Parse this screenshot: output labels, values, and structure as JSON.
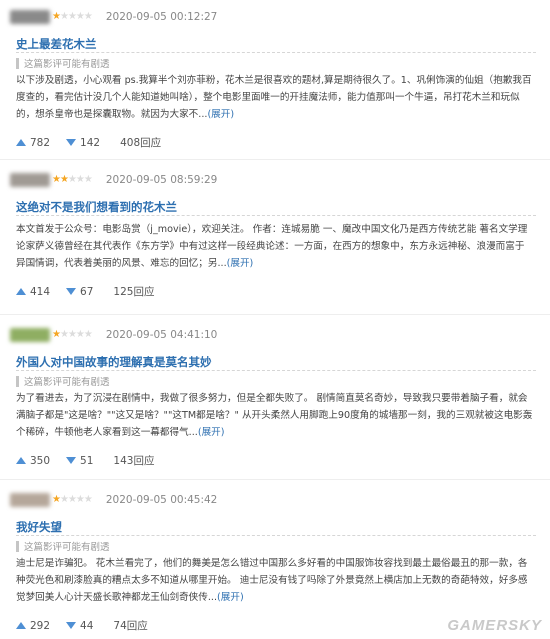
{
  "reviews": [
    {
      "avatar_color": "#8a8a8a",
      "rating": 1,
      "date": "2020-09-05 00:12:27",
      "title": "史上最差花木兰",
      "spoiler": "这篇影评可能有剧透",
      "body": "以下涉及剧透，小心观看 ps.我算半个刘亦菲粉，花木兰是很喜欢的题材,算是期待很久了。1、巩俐饰演的仙姐（抱歉我百度查的，看完估计没几个人能知道她叫啥），整个电影里面唯一的开挂魔法师，能力值那叫一个牛逼，吊打花木兰和玩似的，想杀皇帝也是探囊取物。就因为大家不...",
      "expand": "(展开)",
      "up": "782",
      "down": "142",
      "replies": "408回应"
    },
    {
      "avatar_color": "#a09a94",
      "rating": 2,
      "date": "2020-09-05 08:59:29",
      "title": "这绝对不是我们想看到的花木兰",
      "spoiler": "",
      "body": "本文首发于公众号：电影岛赏（j_movie），欢迎关注。 作者：连城易脆 一、魔改中国文化乃是西方传统艺能 著名文学理论家萨义德曾经在其代表作《东方学》中有过这样一段经典论述：一方面，在西方的想象中，东方永远神秘、浪漫而富于异国情调，代表着美丽的风景、难忘的回忆；另...",
      "expand": "(展开)",
      "up": "414",
      "down": "67",
      "replies": "125回应"
    },
    {
      "avatar_color": "#8fae62",
      "rating": 1,
      "date": "2020-09-05 04:41:10",
      "title": "外国人对中国故事的理解真是莫名其妙",
      "spoiler": "这篇影评可能有剧透",
      "body": "为了看进去，为了沉浸在剧情中，我做了很多努力，但是全都失败了。 剧情简直莫名奇妙，导致我只要带着脑子看，就会满脑子都是\"这是啥？\"\"这又是啥？\"\"这TM都是啥？\" 从开头柔然人用脚跑上90度角的城墙那一刻，我的三观就被这电影轰个稀碎，牛顿他老人家看到这一幕都得气...",
      "expand": "(展开)",
      "up": "350",
      "down": "51",
      "replies": "143回应"
    },
    {
      "avatar_color": "#b5a79a",
      "rating": 1,
      "date": "2020-09-05 00:45:42",
      "title": "我好失望",
      "spoiler": "这篇影评可能有剧透",
      "body": "迪士尼是诈骗犯。 花木兰看完了，他们的舞美是怎么错过中国那么多好看的中国服饰妆容找到最土最俗最丑的那一款，各种荧光色和刷漆脸真的糟点太多不知道从哪里开始。 迪士尼没有钱了吗除了外景竟然上横店加上无数的奇葩特效，好多感觉梦回美人心计天盛长歌神都龙王仙剑奇侠传...",
      "expand": "(展开)",
      "up": "292",
      "down": "44",
      "replies": "74回应"
    }
  ],
  "watermark": "GAMERSKY"
}
